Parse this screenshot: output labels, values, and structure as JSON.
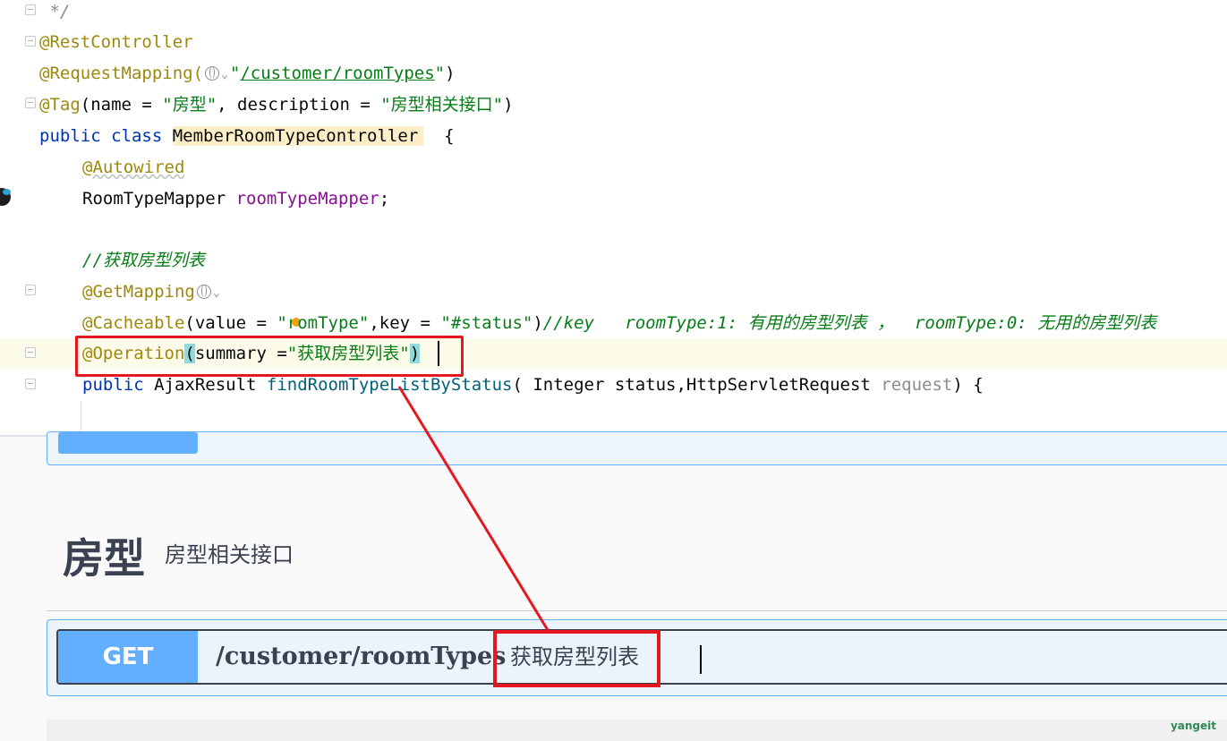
{
  "editor": {
    "lines": {
      "l0": " */",
      "l1_ann": "@RestController",
      "l2_ann": "@RequestMapping(",
      "l2_str_q1": "\"",
      "l2_url": "/customer/roomTypes",
      "l2_str_q2": "\"",
      "l2_close": ")",
      "l3_ann": "@Tag",
      "l3_open": "(name = ",
      "l3_str1": "\"房型\"",
      "l3_mid": ", description = ",
      "l3_str2": "\"房型相关接口\"",
      "l3_close": ")",
      "l4_kw": "public class ",
      "l4_cls": "MemberRoomTypeController",
      "l4_brace": "  {",
      "l5_ann": "@Autowired",
      "l6_type": "RoomTypeMapper ",
      "l6_field": "roomTypeMapper",
      "l6_semi": ";",
      "l8_cmt": "//获取房型列表",
      "l9_ann": "@GetMapping",
      "l10_ann": "@Cacheable",
      "l10_a": "(value = ",
      "l10_s1a": "\"r",
      "l10_s1b": "omType\"",
      "l10_b": ",key = ",
      "l10_s2": "\"#status\"",
      "l10_c": ")",
      "l10_cmt": "//key   roomType:1: 有用的房型列表 ，  roomType:0: 无用的房型列表",
      "l11_ann": "@Operation",
      "l11_open": "(",
      "l11_a": "summary =",
      "l11_str": "\"获取房型列表\"",
      "l11_close": ")",
      "l12_kw": "public ",
      "l12_type": "AjaxResult ",
      "l12_method": "findRoomTypeListByStatus",
      "l12_params": "( Integer status,HttpServletRequest ",
      "l12_param": "request",
      "l12_end": ") {"
    }
  },
  "swagger": {
    "tag_name": "房型",
    "tag_description": "房型相关接口",
    "operation": {
      "method": "GET",
      "path": "/customer/roomTypes",
      "summary": "获取房型列表"
    },
    "watermark": "yangeit"
  },
  "colors": {
    "get_method": "#61affe",
    "highlight_box": "#e5171f",
    "annotation": "#9e880d",
    "keyword": "#0033b3",
    "string": "#067d17"
  }
}
